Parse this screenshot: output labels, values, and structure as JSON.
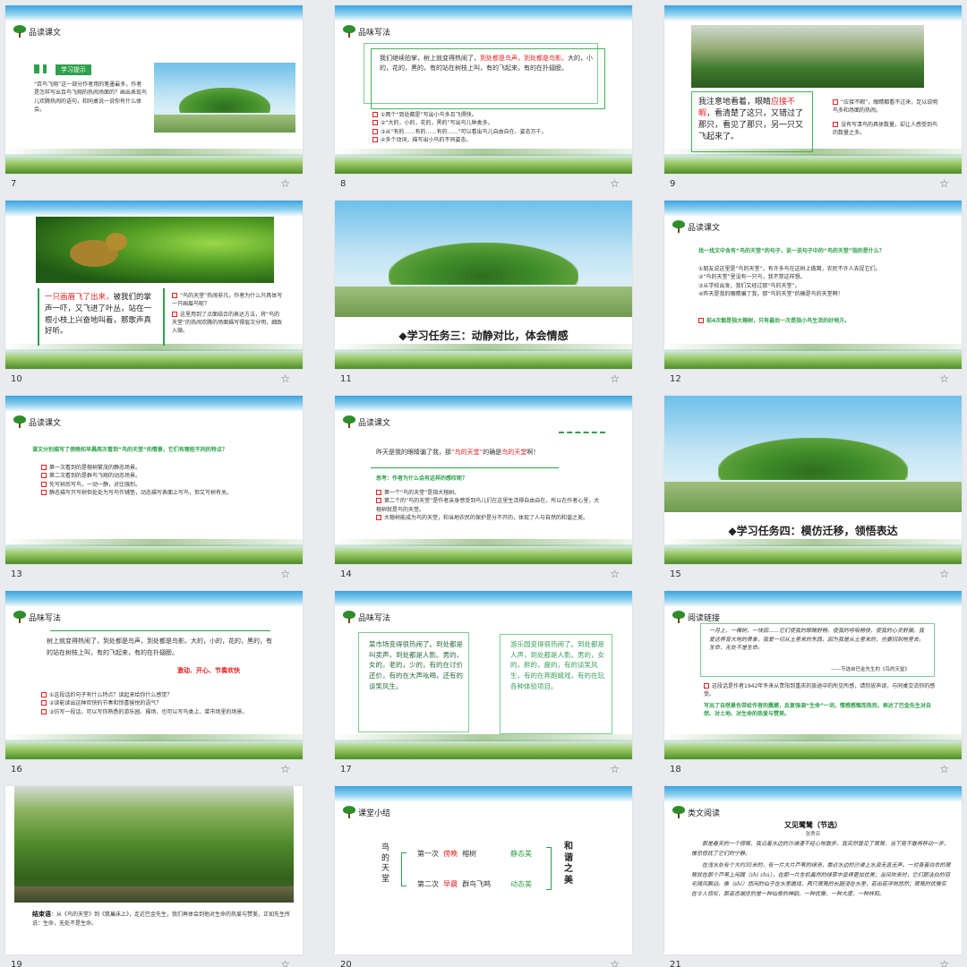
{
  "slides": [
    {
      "num": "7",
      "header": "品读课文",
      "tag": "学习提示",
      "text": "“百鸟飞翔”这一部分作者用的笔墨最多，作者是怎样写出百鸟飞翔的热闹场面的？画出表现鸟儿欢腾热闹的语句，和同桌说一说你有什么体会。"
    },
    {
      "num": "8",
      "header": "品味写法",
      "para_a": "我们继续拍掌，树上就变得热闹了，",
      "para_b": "到处都是鸟声，",
      "para_c": "到处都是鸟影。",
      "para_d": "大的，小的，花的，黑的，有的站在树枝上叫，有的飞起来，有的在扑翅膀。",
      "items": [
        "①两个“到处都是”写出小鸟多且飞得快。",
        "②“大的，小的，花的，黑的”写出鸟儿种类多。",
        "③从“有的……有的……有的……”可以看出鸟儿自由自在、姿态万千。",
        "④多个动词，描写出小鸟的不同姿态。"
      ]
    },
    {
      "num": "9",
      "main_a": "我注意地看着，眼睛",
      "main_b": "应接不暇",
      "main_c": "，看清楚了这只，又错过了那只，看见了那只，另一只又飞起来了。",
      "items": [
        "“应接不暇”，眼睛都看不过来，足以说明鸟多和场面的热闹。",
        "没有写清鸟的具体数量，却让人感受到鸟的数量之多。"
      ]
    },
    {
      "num": "10",
      "main_a": "一只画眉飞了出来，",
      "main_b": "被我们的掌声一吓，又飞进了叶丛，站在一根小枝上兴奋地叫着，那歌声真好听。",
      "items": [
        "“鸟的天堂”热闹非凡，作者为什么只具体写一只画眉鸟呢？",
        "这里用到了点面结合的表达方法，将“鸟的天堂”的热闹欢腾的场面描写得层次分明，细致入微。"
      ]
    },
    {
      "num": "11",
      "title": "◆学习任务三：动静对比，体会情感"
    },
    {
      "num": "12",
      "header": "品读课文",
      "question": "找一找文中含有“鸟的天堂”的句子，说一说句子中的“鸟的天堂”指的是什么？",
      "items": [
        "①朋友说这里是“鸟的天堂”，有许多鸟在这树上做窝，农民不许人去捉它们。",
        "②“鸟的天堂”里没有一只鸟，我不禁这样想。",
        "③从学校出发，我们又经过那“鸟的天堂”。",
        "④昨天是我的眼睛骗了我，那“鸟的天堂”的确是鸟的天堂啊！"
      ],
      "note": "前4次都是指大榕树，只有最后一次是指小鸟生活的好地方。"
    },
    {
      "num": "13",
      "header": "品读课文",
      "question": "课文分别描写了傍晚和早晨两次看到“鸟的天堂”的情景，它们有哪些不同的特点？",
      "items": [
        "第一次看到的是榕树繁茂的静态场景。",
        "第二次看到的是群鸟飞翔的动态场景。",
        "先写树后写鸟，一动一静，对比强烈。",
        "静态描写只写树但处处为写鸟作铺垫，动态描写表面上写鸟，但又写树有关。"
      ]
    },
    {
      "num": "14",
      "header": "品读课文",
      "s_a": "昨天是我的眼睛骗了我，那",
      "s_b": "“鸟的天堂”",
      "s_c": "的确是",
      "s_d": "鸟的天堂",
      "s_e": "啊！",
      "question": "思考：作者为什么会有这样的感叹呢？",
      "items": [
        "第一个“鸟的天堂”是指大榕树。",
        "第二个的“鸟的天堂”是作者亲身感受到鸟儿们在这里生活得自由自在，所以在作者心里，大榕树就是鸟的天堂。",
        "大榕树能成为鸟的天堂，和当地农民的保护是分不开的，体现了人与自然的和谐之美。"
      ]
    },
    {
      "num": "15",
      "title": "◆学习任务四：模仿迁移，领悟表达"
    },
    {
      "num": "16",
      "header": "品味写法",
      "para": "树上就变得热闹了，到处都是鸟声，到处都是鸟影。大的，小的，花的，黑的，有的站在树枝上叫，有的飞起来，有的在扑翅膀。",
      "emotion": "激动、开心、节奏欢快",
      "items": [
        "①这段话的句子有什么特点？读起来给你什么感觉？",
        "②读能读出这种欢快的节奏和惊喜愉悦的语气？",
        "③仿写一段话，可以写你熟悉的游乐园、操场，也可以写鸟类上、菜市场里的场景。"
      ]
    },
    {
      "num": "17",
      "header": "品味写法",
      "left": "菜市场变得很热闹了。到处都是叫卖声，到处都是人影。男的，女的，老的，少的，有的在讨价还价，有的在大声吆喝，还有的谈笑风生。",
      "right": "游乐园变得很热闹了。到处都是人声，到处都是人影。男的，女的，胖的，瘦的，有的谈笑风生，有的在奔跑嬉戏，有的在玩各种体验项目。"
    },
    {
      "num": "18",
      "header": "阅读链接",
      "quote": "一月上，一棵树，一块田……它们使我的眼睛舒畅，使我的呼吸畅快，使我的心灵舒展。我爱这养育大地的景象，我爱一切从土里来的东西，因为我是从土里来的，也要回到地里去。生命，无处不是生命。",
      "source": "——节选自巴金先生的《鸟的天堂》",
      "item": "这段话是作者1942年冬来从贵阳到重庆的旅途中的所见所感，请你放声读，与同桌交流你的感受。",
      "note": "写出了自然景色带给作者的震撼，反复强调“生命”一词，情感感慨而热烈，表达了巴金先生对自然、对土地、对生命的热爱与赞美。"
    },
    {
      "num": "19",
      "label": "结束语",
      "text": "：从《鸟的天堂》到《筑巢床上》，走近巴金先生，我们再体会到他对生命的热爱与赞美，正如先生所说：生命，无处不是生命。"
    },
    {
      "num": "20",
      "header": "课堂小结",
      "vertical": "鸟的天堂",
      "first": "第一次",
      "first_time": "傍晚",
      "first_obj": "榕树",
      "first_beauty": "静态美",
      "second": "第二次",
      "second_time": "早晨",
      "second_obj": "群鸟飞鸣",
      "second_beauty": "动态美",
      "harmony": "和谐之美"
    },
    {
      "num": "21",
      "header": "类文阅读",
      "title": "又见鹭鸶（节选）",
      "author": "张秀亚",
      "p1": "那是春天的一个傍晚，我沿着水边的沙滩漫不经心地散步。我突然瞥见了鹭鸶，当下竟不敢再移动一步，惟恐惊扰了它们的宁静。",
      "p2": "在浅水处有个大约30米的，有一片大片芦苇的绿洲，靠近水边的沙滩上水浪无息无声。一对身着白衣的鹭鸶就在那个芦苇上闲踱（zhí zhú），在那一片生机盎然的绿草中显得更加优美；当风吹来时，它们那洁白的羽毛随风飘动。像（shì）悠闲的仙子在水里嬉戏，两只鹭鸶的长腿浸在水里，若出若浮地悠然；鹭鸶的优雅实在令人惊叹，那姿态端庄的是一种仙骨的神韵。一种优雅，一种大度，一种祥和。"
    }
  ]
}
